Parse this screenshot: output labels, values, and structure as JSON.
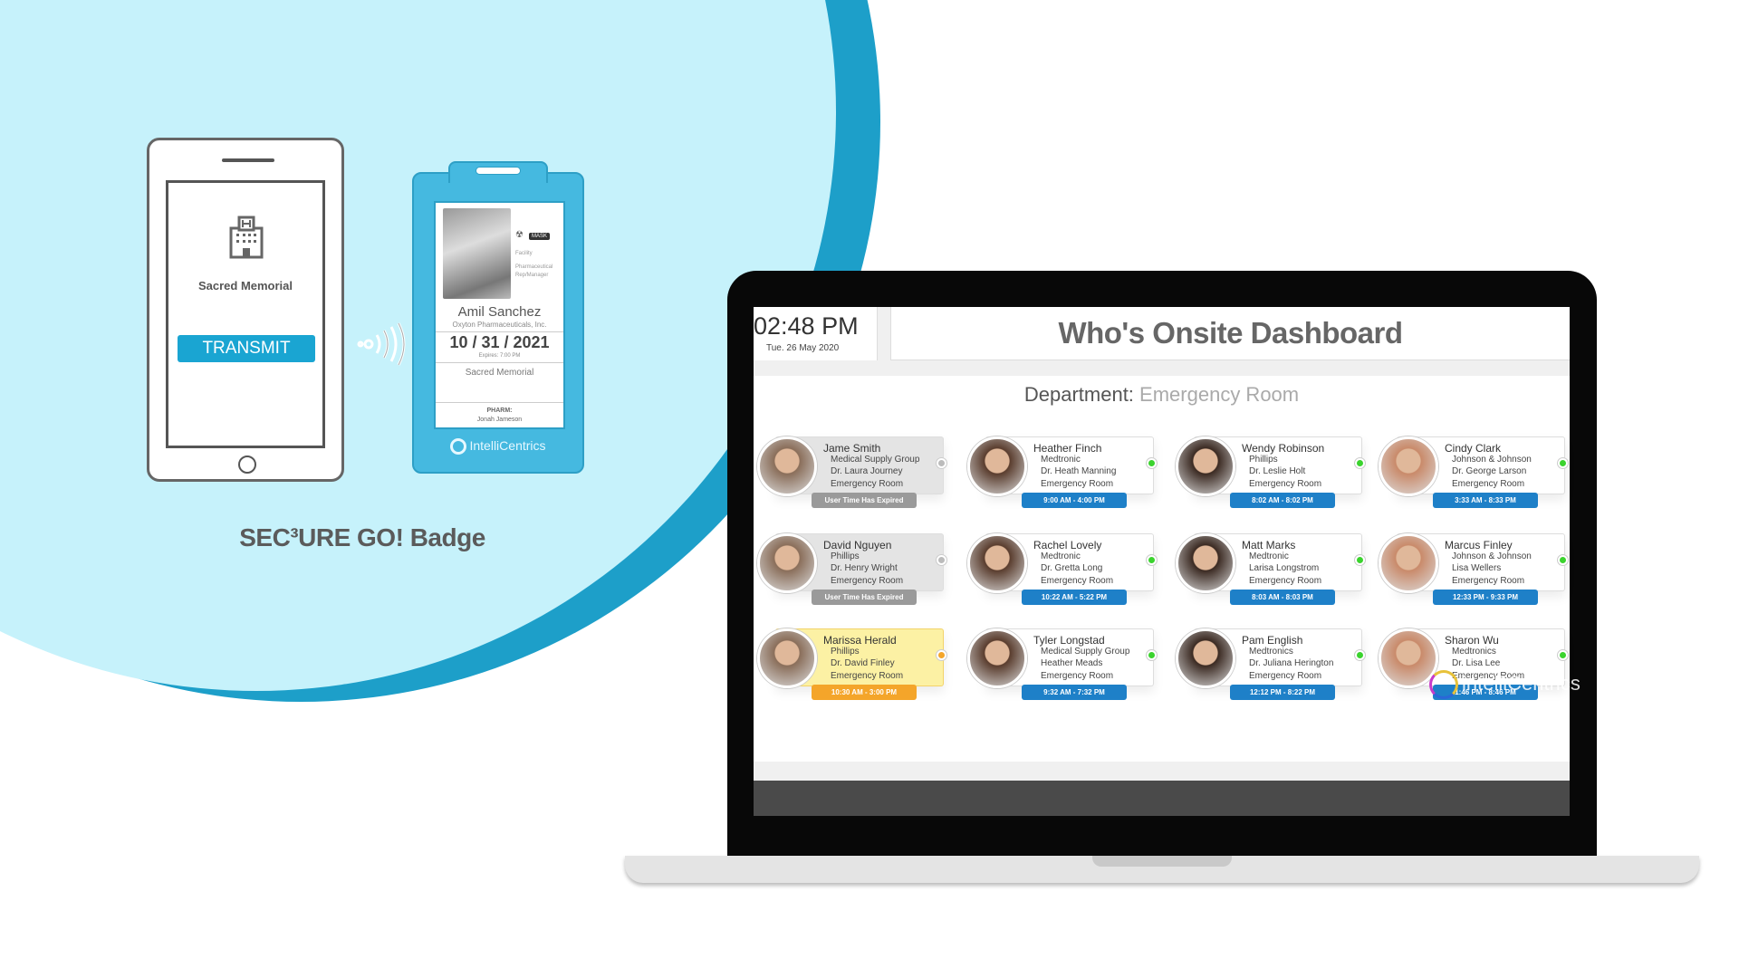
{
  "phone": {
    "facility": "Sacred Memorial",
    "transmit_label": "TRANSMIT",
    "icon": "hospital-building-icon"
  },
  "badge": {
    "icons": [
      "radiation-icon"
    ],
    "mask_label": "MASK",
    "facility_label": "Facility",
    "role": "Pharmaceutical Rep/Manager",
    "name": "Amil Sanchez",
    "company": "Oxyton Pharmaceuticals, Inc.",
    "date": "10 / 31 / 2021",
    "expires": "Expires: 7:00 PM",
    "facility": "Sacred Memorial",
    "pharm_label": "PHARM:",
    "pharm_name": "Jonah Jameson",
    "logo": "IntelliCentrics"
  },
  "caption": "SEC³URE GO! Badge",
  "dashboard": {
    "time": "02:48 PM",
    "date": "Tue. 26 May 2020",
    "title": "Who's Onsite Dashboard",
    "department_label": "Department:",
    "department": "Emergency Room",
    "colors": {
      "active": "#1e80c8",
      "expired": "#9a9a9a",
      "warning": "#f4a52a",
      "online": "#3bd32e"
    },
    "people": [
      {
        "name": "Jame Smith",
        "company": "Medical Supply Group",
        "contact": "Dr. Laura Journey",
        "dept": "Emergency Room",
        "time": "User Time Has Expired",
        "status": "expired"
      },
      {
        "name": "Heather Finch",
        "company": "Medtronic",
        "contact": "Dr. Heath Manning",
        "dept": "Emergency Room",
        "time": "9:00 AM - 4:00 PM",
        "status": "active"
      },
      {
        "name": "Wendy Robinson",
        "company": "Phillips",
        "contact": "Dr. Leslie Holt",
        "dept": "Emergency Room",
        "time": "8:02 AM - 8:02 PM",
        "status": "active"
      },
      {
        "name": "Cindy Clark",
        "company": "Johnson & Johnson",
        "contact": "Dr. George Larson",
        "dept": "Emergency Room",
        "time": "3:33 AM - 8:33 PM",
        "status": "active"
      },
      {
        "name": "David Nguyen",
        "company": "Phillips",
        "contact": "Dr. Henry Wright",
        "dept": "Emergency Room",
        "time": "User Time Has Expired",
        "status": "expired"
      },
      {
        "name": "Rachel Lovely",
        "company": "Medtronic",
        "contact": "Dr. Gretta Long",
        "dept": "Emergency Room",
        "time": "10:22 AM - 5:22 PM",
        "status": "active"
      },
      {
        "name": "Matt Marks",
        "company": "Medtronic",
        "contact": "Larisa Longstrom",
        "dept": "Emergency Room",
        "time": "8:03 AM - 8:03 PM",
        "status": "active"
      },
      {
        "name": "Marcus Finley",
        "company": "Johnson & Johnson",
        "contact": "Lisa Wellers",
        "dept": "Emergency Room",
        "time": "12:33 PM - 9:33 PM",
        "status": "active"
      },
      {
        "name": "Marissa Herald",
        "company": "Phillips",
        "contact": "Dr. David Finley",
        "dept": "Emergency Room",
        "time": "10:30 AM - 3:00 PM",
        "status": "warn"
      },
      {
        "name": "Tyler Longstad",
        "company": "Medical Supply Group",
        "contact": "Heather Meads",
        "dept": "Emergency Room",
        "time": "9:32 AM - 7:32 PM",
        "status": "active"
      },
      {
        "name": "Pam English",
        "company": "Medtronics",
        "contact": "Dr. Juliana Herington",
        "dept": "Emergency Room",
        "time": "12:12 PM - 8:22 PM",
        "status": "active"
      },
      {
        "name": "Sharon Wu",
        "company": "Medtronics",
        "contact": "Dr. Lisa Lee",
        "dept": "Emergency Room",
        "time": "1:46 PM - 8:46 PM",
        "status": "active"
      }
    ]
  },
  "watermark": "intelliCentrics"
}
